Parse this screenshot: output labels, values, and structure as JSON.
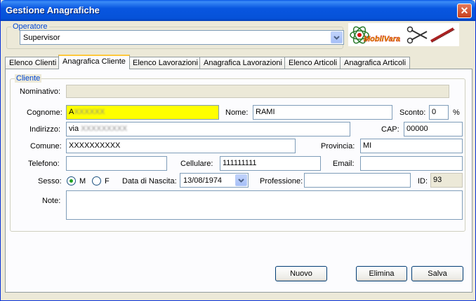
{
  "window": {
    "title": "Gestione Anagrafiche"
  },
  "operatore": {
    "legend": "Operatore",
    "selected": "Supervisor"
  },
  "logo": {
    "text": "MobilVara"
  },
  "tabs": [
    {
      "label": "Elenco Clienti",
      "active": false
    },
    {
      "label": "Anagrafica Cliente",
      "active": true
    },
    {
      "label": "Elenco Lavorazioni",
      "active": false
    },
    {
      "label": "Anagrafica Lavorazioni",
      "active": false
    },
    {
      "label": "Elenco Articoli",
      "active": false
    },
    {
      "label": "Anagrafica Articoli",
      "active": false
    }
  ],
  "cliente": {
    "legend": "Cliente",
    "nominativo": {
      "label": "Nominativo:",
      "value": ""
    },
    "cognome": {
      "label": "Cognome:",
      "value": "A",
      "obscured": "XXXXXX"
    },
    "nome": {
      "label": "Nome:",
      "value": "RAMI"
    },
    "sconto": {
      "label": "Sconto:",
      "value": "0",
      "unit": "%"
    },
    "indirizzo": {
      "label": "Indirizzo:",
      "value": "via",
      "obscured": "XXXXXXXXX"
    },
    "cap": {
      "label": "CAP:",
      "value": "00000"
    },
    "comune": {
      "label": "Comune:",
      "value": "XXXXXXXXXX"
    },
    "provincia": {
      "label": "Provincia:",
      "value": "MI"
    },
    "telefono": {
      "label": "Telefono:",
      "value": ""
    },
    "cellulare": {
      "label": "Cellulare:",
      "value": "111111111"
    },
    "email": {
      "label": "Email:",
      "value": ""
    },
    "sesso": {
      "label": "Sesso:",
      "option_m": "M",
      "option_f": "F",
      "selected": "M"
    },
    "data_nascita": {
      "label": "Data di Nascita:",
      "value": "13/08/1974"
    },
    "professione": {
      "label": "Professione:",
      "value": ""
    },
    "id": {
      "label": "ID:",
      "value": "93"
    },
    "note": {
      "label": "Note:",
      "value": ""
    }
  },
  "buttons": {
    "nuovo": "Nuovo",
    "elimina": "Elimina",
    "salva": "Salva"
  },
  "colors": {
    "title_bar": "#0856e0",
    "legend": "#0046d5",
    "cognome_highlight": "#ffff00",
    "active_tab_accent": "#ffc83c"
  }
}
